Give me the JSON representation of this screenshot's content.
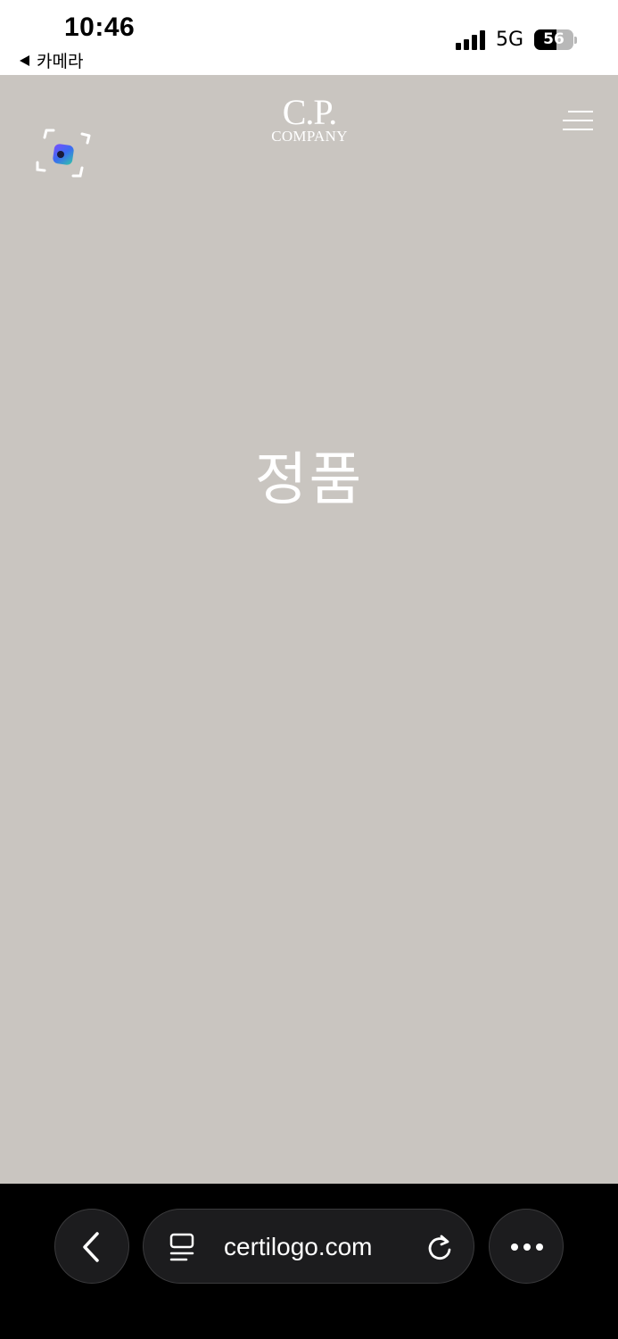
{
  "status_bar": {
    "time": "10:46",
    "back_app": "카메라",
    "network": "5G",
    "battery_level": "56",
    "battery_fraction": 0.56
  },
  "page": {
    "logo_top": "C.P.",
    "logo_bottom": "COMPANY",
    "headline": "정품",
    "background_color": "#c9c5c0",
    "icons": {
      "scan": "scan-frame-icon",
      "menu": "menu-icon"
    }
  },
  "browser": {
    "url": "certilogo.com",
    "icons": {
      "back": "chevron-left-icon",
      "tabs": "tabs-icon",
      "reload": "reload-icon",
      "more": "more-icon"
    }
  }
}
